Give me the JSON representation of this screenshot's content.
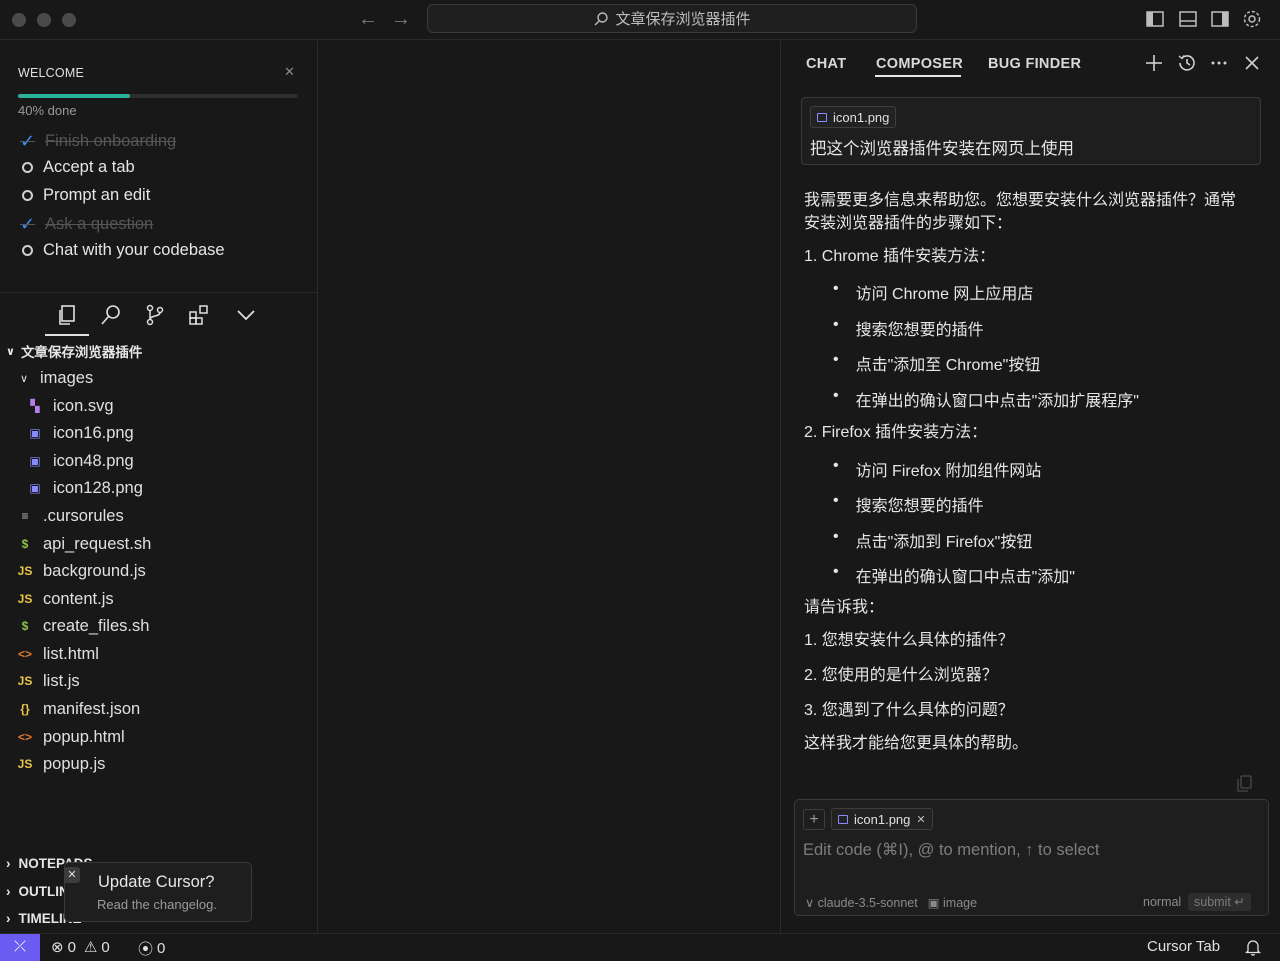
{
  "window": {
    "title": "文章保存浏览器插件"
  },
  "welcome": {
    "title": "WELCOME",
    "progress_text": "40% done",
    "progress_fraction": 0.4,
    "tasks": [
      {
        "label": "Finish onboarding",
        "done": true
      },
      {
        "label": "Accept a tab",
        "done": false
      },
      {
        "label": "Prompt an edit",
        "done": false
      },
      {
        "label": "Ask a question",
        "done": true
      },
      {
        "label": "Chat with your codebase",
        "done": false
      }
    ]
  },
  "explorer": {
    "root": "文章保存浏览器插件",
    "folder": "images",
    "images": [
      "icon.svg",
      "icon16.png",
      "icon48.png",
      "icon128.png"
    ],
    "files": [
      {
        "name": ".cursorules",
        "icon": "≡",
        "color": "#bdbdbd"
      },
      {
        "name": "api_request.sh",
        "icon": "$",
        "color": "#8bc34a"
      },
      {
        "name": "background.js",
        "icon": "JS",
        "color": "#e8c547"
      },
      {
        "name": "content.js",
        "icon": "JS",
        "color": "#e8c547"
      },
      {
        "name": "create_files.sh",
        "icon": "$",
        "color": "#8bc34a"
      },
      {
        "name": "list.html",
        "icon": "<>",
        "color": "#e37933"
      },
      {
        "name": "list.js",
        "icon": "JS",
        "color": "#e8c547"
      },
      {
        "name": "manifest.json",
        "icon": "{}",
        "color": "#e8c547"
      },
      {
        "name": "popup.html",
        "icon": "<>",
        "color": "#e37933"
      },
      {
        "name": "popup.js",
        "icon": "JS",
        "color": "#e8c547"
      }
    ],
    "bottom_sections": [
      "NOTEPADS",
      "OUTLINE",
      "TIMELINE"
    ]
  },
  "toast": {
    "title": "Update Cursor?",
    "subtitle": "Read the changelog.",
    "close": "✕"
  },
  "panel": {
    "tabs": [
      "CHAT",
      "COMPOSER",
      "BUG FINDER"
    ],
    "active_tab": "COMPOSER",
    "user_message": {
      "attachment": "icon1.png",
      "text": "把这个浏览器插件安装在网页上使用"
    },
    "response": {
      "intro_1": "我需要更多信息来帮助您。您想要安装什么浏览器插件？通常",
      "intro_2": "安装浏览器插件的步骤如下：",
      "h1": "1. Chrome 插件安装方法：",
      "chrome_steps": [
        "访问 Chrome 网上应用店",
        "搜索您想要的插件",
        "点击\"添加至 Chrome\"按钮",
        "在弹出的确认窗口中点击\"添加扩展程序\""
      ],
      "h2": "2. Firefox 插件安装方法：",
      "firefox_steps": [
        "访问 Firefox 附加组件网站",
        "搜索您想要的插件",
        "点击\"添加到 Firefox\"按钮",
        "在弹出的确认窗口中点击\"添加\""
      ],
      "ask": "请告诉我：",
      "q1": "1. 您想安装什么具体的插件？",
      "q2": "2. 您使用的是什么浏览器？",
      "q3": "3. 您遇到了什么具体的问题？",
      "closing": "这样我才能给您更具体的帮助。"
    },
    "composer": {
      "attachment": "icon1.png",
      "placeholder": "Edit code (⌘I), @ to mention, ↑ to select",
      "model": "claude-3.5-sonnet",
      "image_label": "image",
      "mode": "normal",
      "submit": "submit"
    }
  },
  "status": {
    "errors": "0",
    "warnings": "0",
    "ports": "0",
    "cursor_tab": "Cursor Tab"
  }
}
